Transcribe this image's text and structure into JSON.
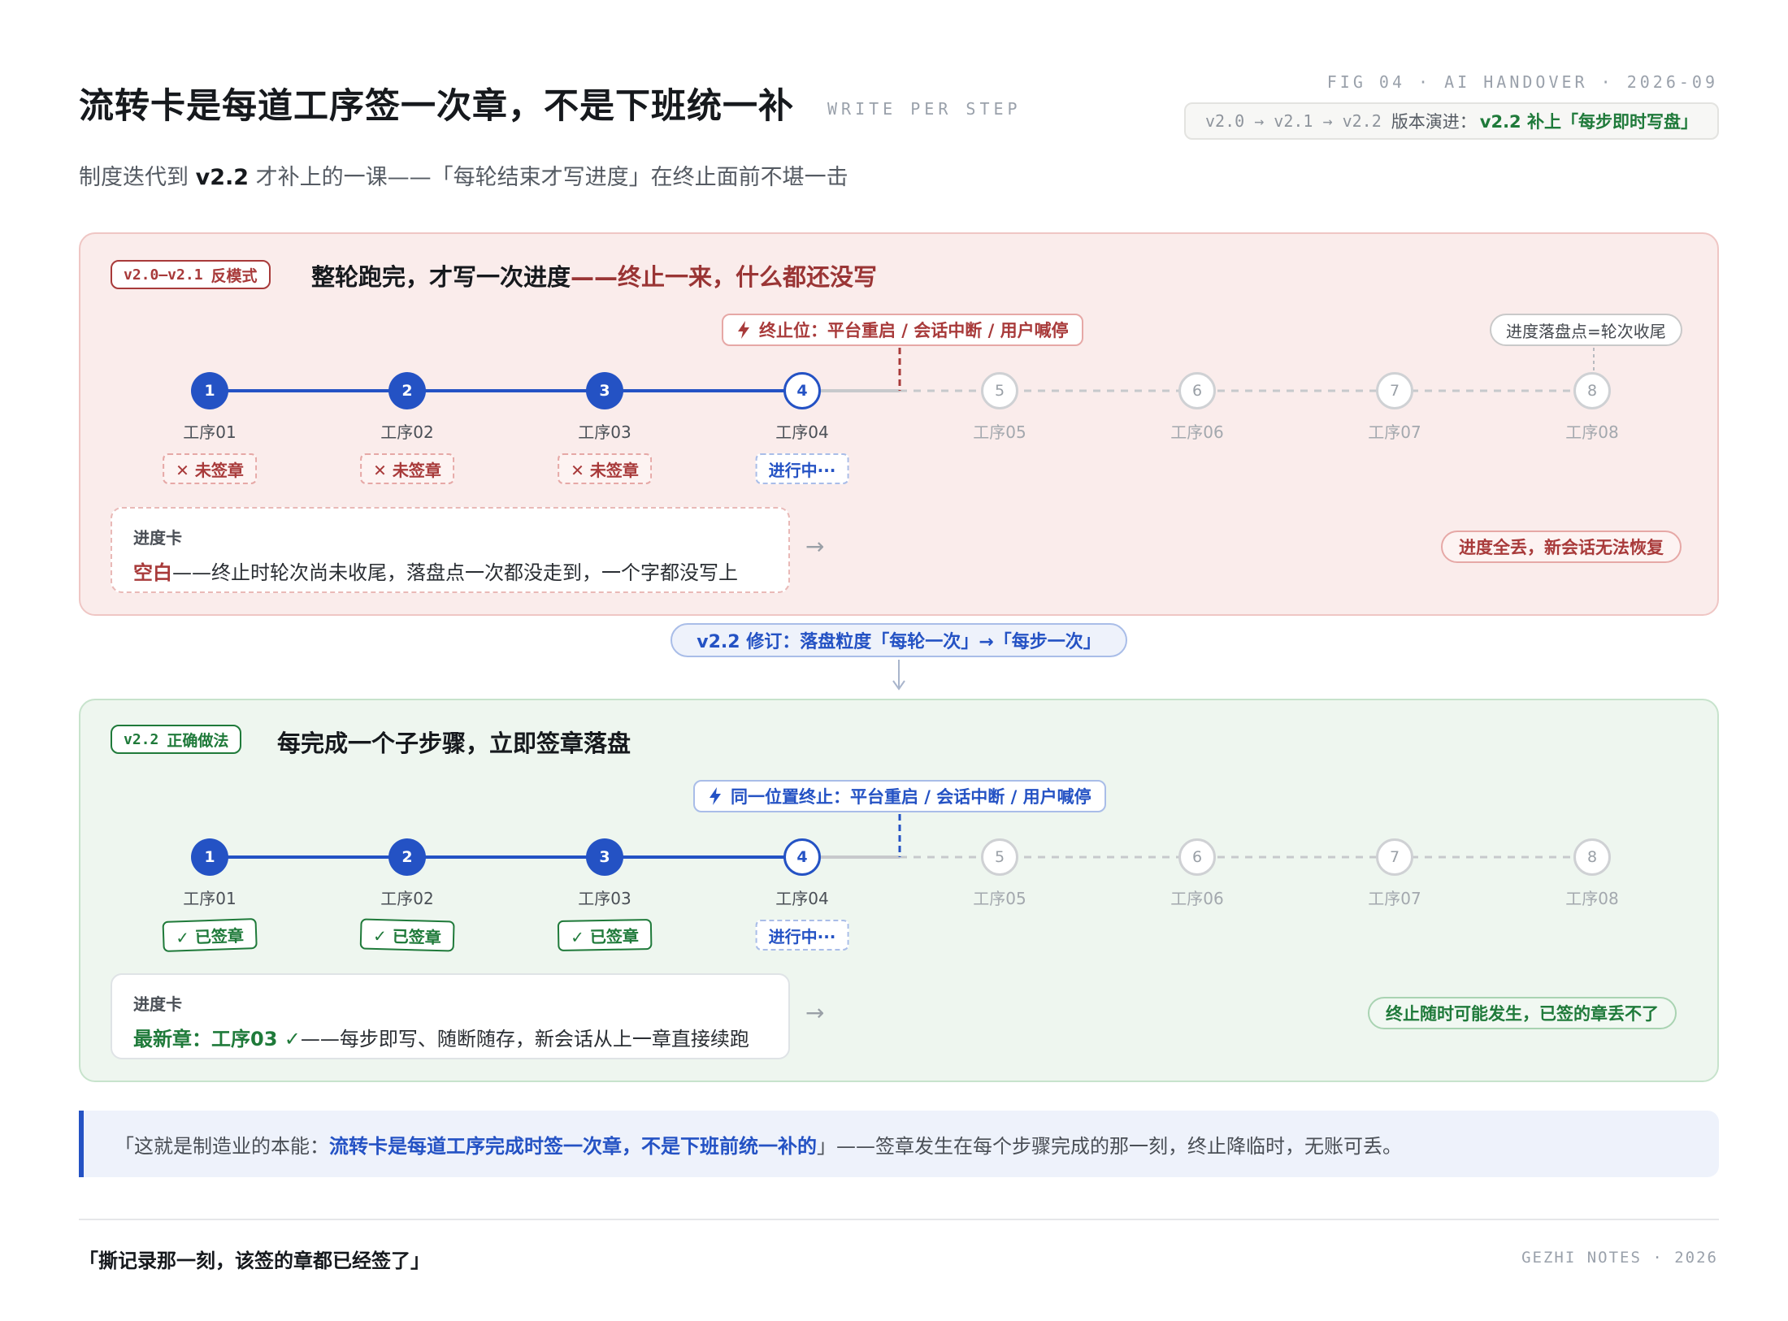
{
  "header": {
    "title": "流转卡是每道工序签一次章，不是下班统一补",
    "title_tag": "WRITE PER STEP",
    "fig_meta": "FIG 04 · AI HANDOVER · 2026-09",
    "version_path": "v2.0 → v2.1 → v2.2",
    "version_label": "版本演进：",
    "version_highlight": "v2.2 补上「每步即时写盘」",
    "subtitle_pre": "制度迭代到 ",
    "subtitle_bold": "v2.2",
    "subtitle_post": " 才补上的一课——「每轮结束才写进度」在终止面前不堪一击"
  },
  "anti": {
    "tag_version": "v2.0–v2.1",
    "tag_label": "反模式",
    "heading": "整轮跑完，才写一次进度",
    "heading_dash": "——终止一来，什么都还没写",
    "interrupt_label": "终止位：平台重启 / 会话中断 / 用户喊停",
    "commit_label": "进度落盘点=轮次收尾",
    "steps": [
      {
        "n": "1",
        "label": "工序01",
        "state": "done",
        "stamp": "✕ 未签章"
      },
      {
        "n": "2",
        "label": "工序02",
        "state": "done",
        "stamp": "✕ 未签章"
      },
      {
        "n": "3",
        "label": "工序03",
        "state": "done",
        "stamp": "✕ 未签章"
      },
      {
        "n": "4",
        "label": "工序04",
        "state": "cur",
        "stamp": "进行中···"
      },
      {
        "n": "5",
        "label": "工序05",
        "state": "todo",
        "stamp": ""
      },
      {
        "n": "6",
        "label": "工序06",
        "state": "todo",
        "stamp": ""
      },
      {
        "n": "7",
        "label": "工序07",
        "state": "todo",
        "stamp": ""
      },
      {
        "n": "8",
        "label": "工序08",
        "state": "todo",
        "stamp": ""
      }
    ],
    "card_title": "进度卡",
    "card_key": "空白",
    "card_body": "——终止时轮次尚未收尾，落盘点一次都没走到，一个字都没写上",
    "arrow": "→",
    "result": "进度全丢，新会话无法恢复"
  },
  "fix": {
    "label": "v2.2 修订：落盘粒度「每轮一次」→「每步一次」",
    "arrow": "↓"
  },
  "good": {
    "tag_version": "v2.2",
    "tag_label": "正确做法",
    "heading": "每完成一个子步骤，立即签章落盘",
    "interrupt_label": "同一位置终止：平台重启 / 会话中断 / 用户喊停",
    "steps": [
      {
        "n": "1",
        "label": "工序01",
        "state": "done",
        "stamp": "✓ 已签章"
      },
      {
        "n": "2",
        "label": "工序02",
        "state": "done",
        "stamp": "✓ 已签章"
      },
      {
        "n": "3",
        "label": "工序03",
        "state": "done",
        "stamp": "✓ 已签章"
      },
      {
        "n": "4",
        "label": "工序04",
        "state": "cur",
        "stamp": "进行中···"
      },
      {
        "n": "5",
        "label": "工序05",
        "state": "todo",
        "stamp": ""
      },
      {
        "n": "6",
        "label": "工序06",
        "state": "todo",
        "stamp": ""
      },
      {
        "n": "7",
        "label": "工序07",
        "state": "todo",
        "stamp": ""
      },
      {
        "n": "8",
        "label": "工序08",
        "state": "todo",
        "stamp": ""
      }
    ],
    "card_title": "进度卡",
    "card_key": "最新章：工序03 ✓",
    "card_body": "——每步即写、随断随存，新会话从上一章直接续跑",
    "arrow": "→",
    "result": "终止随时可能发生，已签的章丢不了"
  },
  "quote": {
    "pre": "「这就是制造业的本能：",
    "bold": "流转卡是每道工序完成时签一次章，不是下班前统一补的",
    "post": "」——签章发生在每个步骤完成的那一刻，终止降临时，无账可丢。"
  },
  "footer": {
    "left": "「撕记录那一刻，该签的章都已经签了」",
    "right": "GEZHI NOTES · 2026"
  },
  "colors": {
    "done_blue": "#2452c4",
    "anti_red": "#a83a3a",
    "good_green": "#1f7a3a",
    "todo_gray": "#cfd1d4"
  }
}
